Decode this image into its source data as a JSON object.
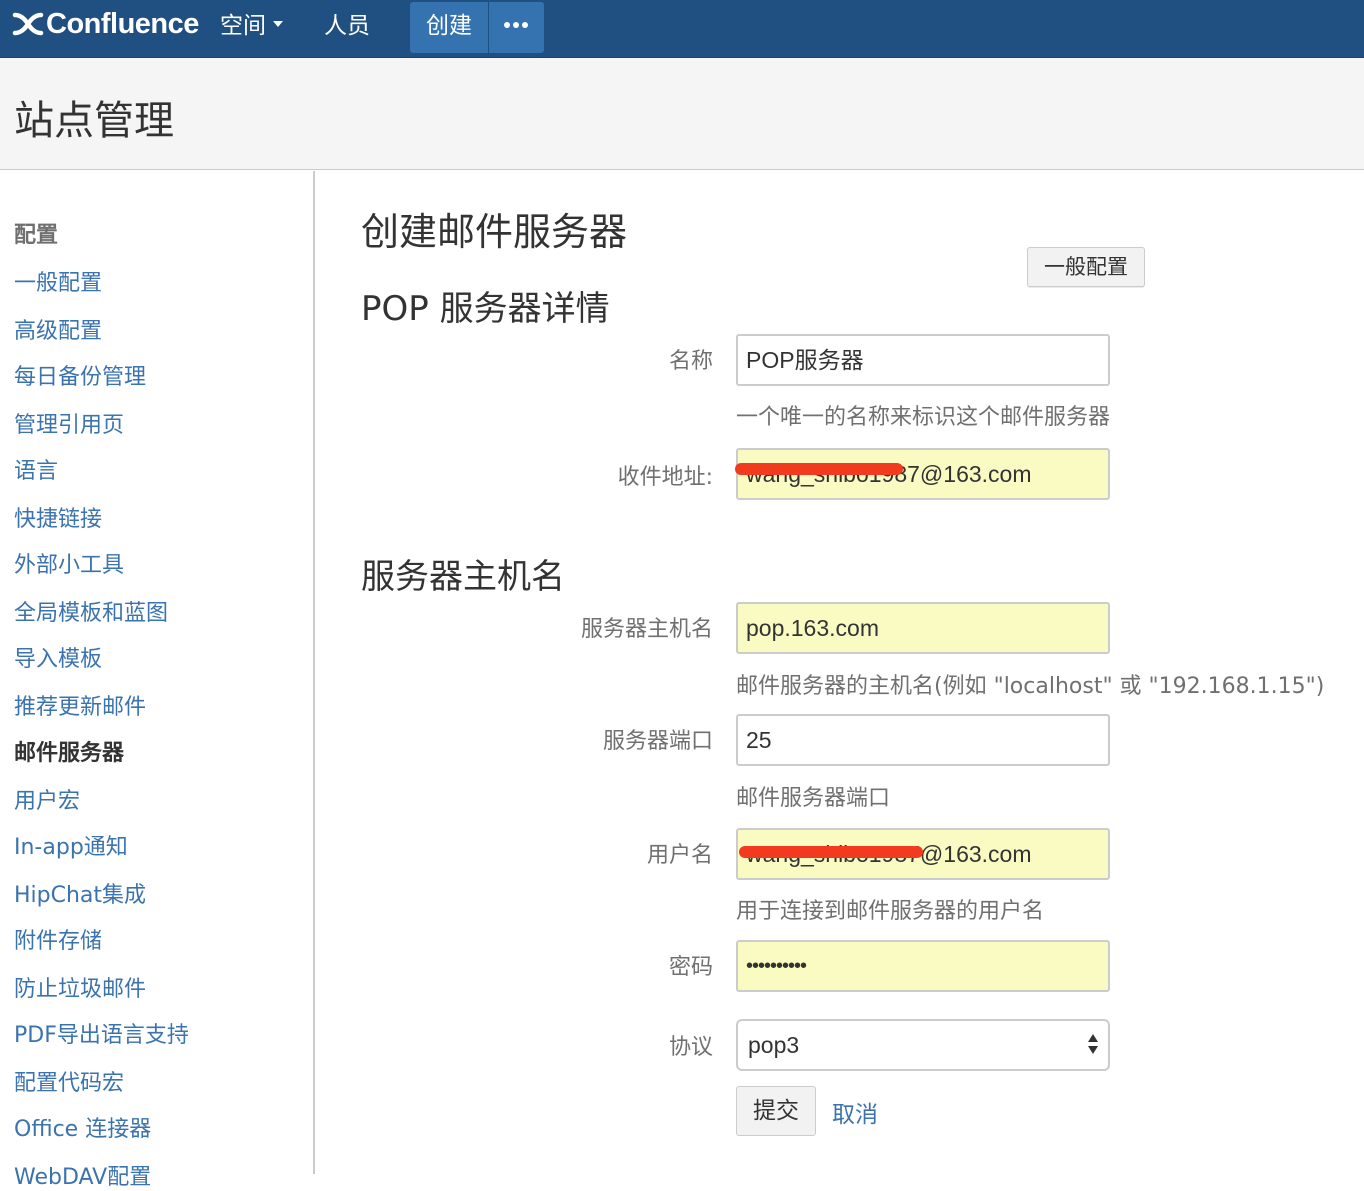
{
  "nav": {
    "logo_text": "Confluence",
    "spaces": "空间",
    "people": "人员",
    "create": "创建",
    "more_icon": "more-dots-icon"
  },
  "page": {
    "title": "站点管理"
  },
  "sidebar": {
    "heading": "配置",
    "items": [
      "一般配置",
      "高级配置",
      "每日备份管理",
      "管理引用页",
      "语言",
      "快捷链接",
      "外部小工具",
      "全局模板和蓝图",
      "导入模板",
      "推荐更新邮件",
      "邮件服务器",
      "用户宏",
      "In-app通知",
      "HipChat集成",
      "附件存储",
      "防止垃圾邮件",
      "PDF导出语言支持",
      "配置代码宏",
      "Office 连接器",
      "WebDAV配置"
    ],
    "active_index": 10
  },
  "form": {
    "title": "创建邮件服务器",
    "general_button": "一般配置",
    "pop_section": "POP 服务器详情",
    "name_label": "名称",
    "name_value": "POP服务器",
    "name_help": "一个唯一的名称来标识这个邮件服务器",
    "address_label": "收件地址:",
    "address_value": "wang_shibo1987@163.com",
    "host_section": "服务器主机名",
    "host_label": "服务器主机名",
    "host_value": "pop.163.com",
    "host_help": "邮件服务器的主机名(例如 \"localhost\" 或 \"192.168.1.15\")",
    "port_label": "服务器端口",
    "port_value": "25",
    "port_help": "邮件服务器端口",
    "username_label": "用户名",
    "username_value": "wang_shibo1987@163.com",
    "username_help": "用于连接到邮件服务器的用户名",
    "password_label": "密码",
    "password_value": "••••••••••",
    "protocol_label": "协议",
    "protocol_value": "pop3",
    "submit": "提交",
    "cancel": "取消"
  },
  "colors": {
    "nav_bg": "#205081",
    "nav_button": "#3572b0",
    "link": "#3b73af",
    "autofill": "#fafbc2",
    "redaction": "#f23a1f"
  }
}
